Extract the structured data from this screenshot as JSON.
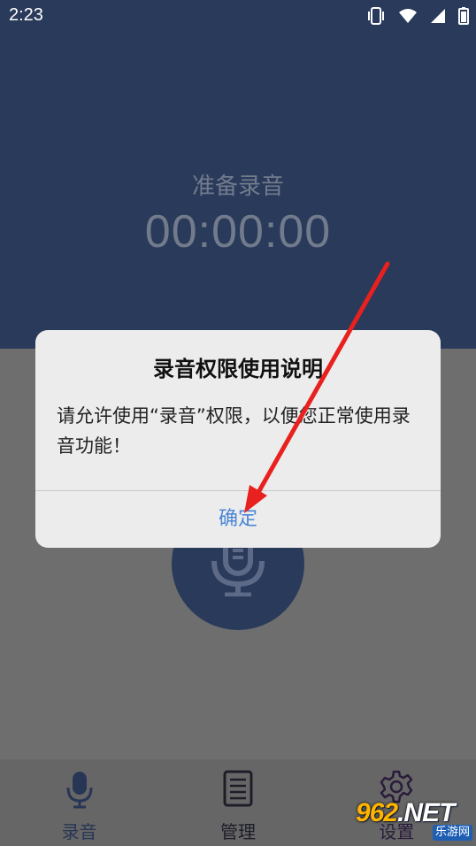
{
  "status_bar": {
    "time": "2:23",
    "icons": [
      "vibrate-icon",
      "wifi-icon",
      "signal-icon",
      "battery-icon"
    ]
  },
  "recorder": {
    "ready_label": "准备录音",
    "timer": "00:00:00"
  },
  "dialog": {
    "title": "录音权限使用说明",
    "message": "请允许使用“录音”权限，以便您正常使用录音功能！",
    "confirm_label": "确定"
  },
  "bottom_nav": {
    "items": [
      {
        "label": "录音",
        "icon": "microphone-icon"
      },
      {
        "label": "管理",
        "icon": "document-list-icon"
      },
      {
        "label": "设置",
        "icon": "gear-icon"
      }
    ]
  },
  "watermark": {
    "main_prefix": "962",
    "main_suffix": ".NET",
    "sub": "乐游网"
  },
  "colors": {
    "header_bg": "#293a5b",
    "overlay_bg": "#6e6e6e",
    "dialog_bg": "#ececec",
    "confirm_text": "#4a86d6",
    "annotation": "#e8201e"
  }
}
